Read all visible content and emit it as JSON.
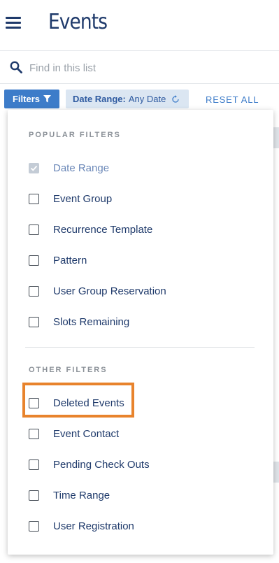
{
  "header": {
    "title": "Events"
  },
  "search": {
    "placeholder": "Find in this list"
  },
  "filterbar": {
    "filters_label": "Filters",
    "chip_key": "Date Range:",
    "chip_value": "Any Date",
    "reset_all": "RESET ALL"
  },
  "dropdown": {
    "popular_title": "POPULAR FILTERS",
    "popular": [
      {
        "label": "Date Range",
        "checked": true
      },
      {
        "label": "Event Group",
        "checked": false
      },
      {
        "label": "Recurrence Template",
        "checked": false
      },
      {
        "label": "Pattern",
        "checked": false
      },
      {
        "label": "User Group Reservation",
        "checked": false
      },
      {
        "label": "Slots Remaining",
        "checked": false
      }
    ],
    "other_title": "OTHER FILTERS",
    "other": [
      {
        "label": "Deleted Events",
        "checked": false
      },
      {
        "label": "Event Contact",
        "checked": false
      },
      {
        "label": "Pending Check Outs",
        "checked": false
      },
      {
        "label": "Time Range",
        "checked": false
      },
      {
        "label": "User Registration",
        "checked": false
      }
    ]
  },
  "colors": {
    "primary": "#3d7cc9",
    "text": "#1f3a6b",
    "highlight": "#e8832c",
    "chip_bg": "#dbe6f2"
  }
}
